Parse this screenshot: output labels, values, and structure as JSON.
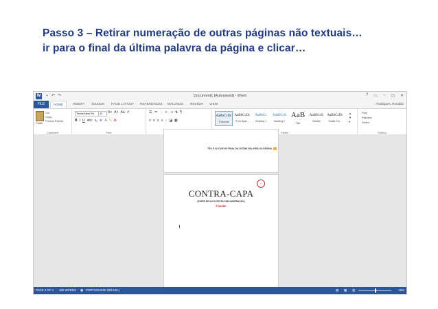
{
  "heading": {
    "line1": "Passo 3 – Retirar numeração de outras páginas não textuais…",
    "line2": "ir para o final da última palavra da página e clicar…"
  },
  "window": {
    "title": "Document1 [Autosaved] - Word",
    "controls": [
      "?",
      "▭",
      "–",
      "▢",
      "✕"
    ],
    "user": "Rodrigues, Ronaldo"
  },
  "tabs": {
    "file": "FILE",
    "home": "HOME",
    "others": [
      "INSERT",
      "DESIGN",
      "PAGE LAYOUT",
      "REFERENCES",
      "MAILINGS",
      "REVIEW",
      "VIEW"
    ]
  },
  "ribbon": {
    "clipboard": {
      "paste": "Paste",
      "cut": "Cut",
      "copy": "Copy",
      "format_painter": "Format Painter",
      "label": "Clipboard"
    },
    "font": {
      "name": "Times New Ro",
      "size": "12",
      "label": "Font"
    },
    "paragraph": {
      "label": "Paragraph"
    },
    "styles": {
      "items": [
        {
          "sample": "AaBbCcDc",
          "name": "¶ Normal"
        },
        {
          "sample": "AaBbCcDc",
          "name": "¶ No Spac..."
        },
        {
          "sample": "AaBbCc",
          "name": "Heading 1"
        },
        {
          "sample": "AaBbCcE",
          "name": "Heading 2"
        },
        {
          "sample": "AaB",
          "name": "Title"
        },
        {
          "sample": "AaBbCcE",
          "name": "Subtitle"
        },
        {
          "sample": "AaBbCcDc",
          "name": "Subtle Em..."
        }
      ],
      "label": "Styles"
    },
    "editing": {
      "find": "Find",
      "replace": "Replace",
      "select": "Select",
      "label": "Editing"
    }
  },
  "document": {
    "page1_endline": "TÃO E CLICAR NO FINAL DA ÚLTIMA PALAVRA DA PÁGINA",
    "page2_title": "CONTRA-CAPA",
    "page2_subtitle": "(FAZER DE NOVO ESTAS SEM NUMERAÇÃO)",
    "page2_red": "É ASSIM!",
    "page_number_marker": "1"
  },
  "status": {
    "page": "PAGE 2 OF 4",
    "words": "489 WORDS",
    "language": "PORTUGUESE (BRAZIL)",
    "zoom": "49%"
  }
}
